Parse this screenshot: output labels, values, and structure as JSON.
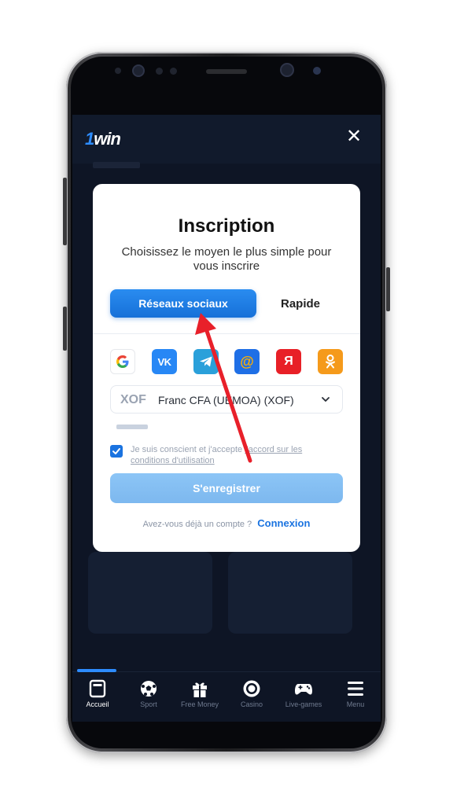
{
  "app": {
    "logo_prefix": "1",
    "logo_text": "win"
  },
  "header": {
    "close_symbol": "✕"
  },
  "modal": {
    "title": "Inscription",
    "subtitle": "Choisissez le moyen le plus simple pour vous inscrire",
    "tabs": [
      {
        "label": "Réseaux sociaux",
        "active": true
      },
      {
        "label": "Rapide",
        "active": false
      }
    ],
    "social_icons": [
      {
        "name": "google-icon",
        "glyph": "G",
        "color": "#ffffff"
      },
      {
        "name": "vk-icon",
        "glyph": "VK",
        "color": "#2787f5"
      },
      {
        "name": "telegram-icon",
        "glyph": "",
        "color": "#2aa0da"
      },
      {
        "name": "mail-ru-icon",
        "glyph": "@",
        "color": "#1f6fe6"
      },
      {
        "name": "yandex-icon",
        "glyph": "Я",
        "color": "#e82027"
      },
      {
        "name": "odnoklassniki-icon",
        "glyph": "ok",
        "color": "#f59a1b"
      }
    ],
    "currency": {
      "code": "XOF",
      "name": "Franc CFA (UEMOA) (XOF)"
    },
    "terms": {
      "prefix": "Je suis conscient et j'accepte",
      "link": "l'accord sur les conditions d'utilisation",
      "checked": true
    },
    "register_label": "S'enregistrer",
    "login_prompt": "Avez-vous déjà un compte ?",
    "login_link": "Connexion"
  },
  "colors": {
    "accent": "#1a73e0",
    "screen_bg": "#0e1525",
    "arrow": "#e8202a"
  },
  "bottom_nav": [
    {
      "label": "Accueil",
      "icon": "home-icon",
      "active": true
    },
    {
      "label": "Sport",
      "icon": "soccer-ball-icon",
      "active": false
    },
    {
      "label": "Free Money",
      "icon": "gift-icon",
      "active": false
    },
    {
      "label": "Casino",
      "icon": "casino-chip-icon",
      "active": false
    },
    {
      "label": "Live-games",
      "icon": "gamepad-icon",
      "active": false
    },
    {
      "label": "Menu",
      "icon": "hamburger-menu-icon",
      "active": false
    }
  ]
}
